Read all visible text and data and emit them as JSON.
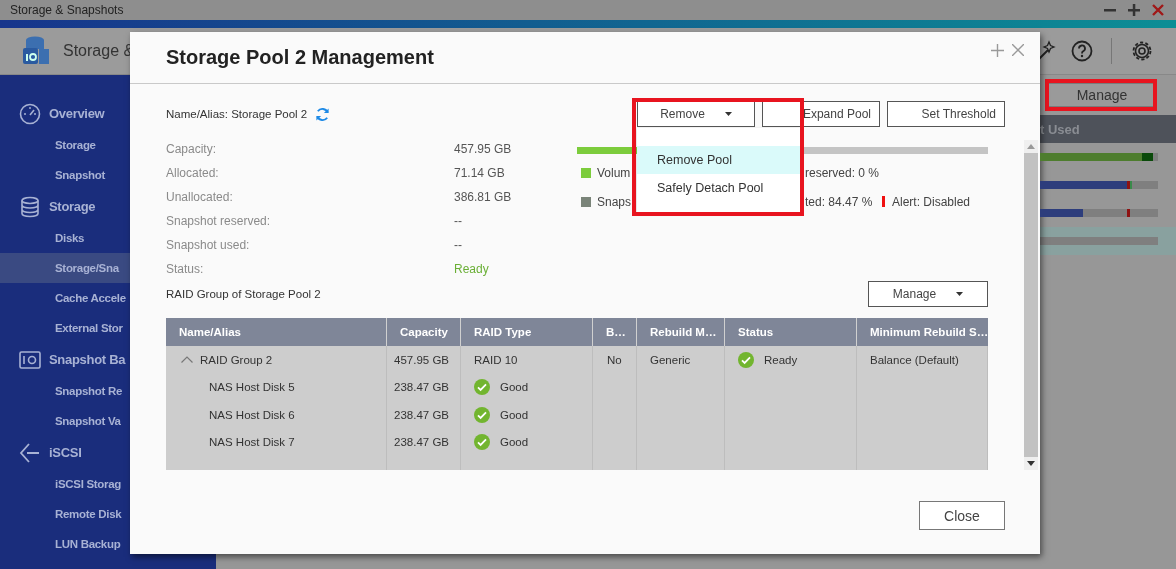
{
  "window": {
    "title": "Storage & Snapshots"
  },
  "app_header": {
    "title": "Storage &"
  },
  "sidebar": {
    "sections": [
      {
        "label": "Overview",
        "children": [
          {
            "label": "Storage",
            "selected": false
          },
          {
            "label": "Snapshot",
            "selected": false
          }
        ]
      },
      {
        "label": "Storage",
        "children": [
          {
            "label": "Disks",
            "selected": false
          },
          {
            "label": "Storage/Sna",
            "selected": true
          },
          {
            "label": "Cache Accele",
            "selected": false
          },
          {
            "label": "External Stor",
            "selected": false
          }
        ]
      },
      {
        "label": "Snapshot Ba",
        "children": [
          {
            "label": "Snapshot Re",
            "selected": false
          },
          {
            "label": "Snapshot Va",
            "selected": false
          }
        ]
      },
      {
        "label": "iSCSI",
        "children": [
          {
            "label": "iSCSI Storag",
            "selected": false
          },
          {
            "label": "Remote Disk",
            "selected": false
          },
          {
            "label": "LUN Backup",
            "selected": false
          }
        ]
      }
    ]
  },
  "main": {
    "manage_button": "Manage",
    "column_header": "t Used",
    "rows": [
      {
        "selected": false,
        "segments": [
          {
            "color": "#4e7d2e",
            "level": 0.864
          },
          {
            "color": "#0a4a0a",
            "level": 0.957
          }
        ]
      },
      {
        "selected": false,
        "segments": [
          {
            "color": "#2d3d7c",
            "level": 0.737
          },
          {
            "color": "#3a8a4a",
            "level": 0.78
          }
        ],
        "marker": {
          "level": 0.754
        }
      },
      {
        "selected": false,
        "segments": [
          {
            "color": "#2d3d7c",
            "level": 0.364
          }
        ],
        "marker": {
          "level": 0.754
        }
      },
      {
        "selected": true
      }
    ]
  },
  "dialog": {
    "title": "Storage Pool 2 Management",
    "name_alias": "Name/Alias: Storage Pool 2",
    "buttons": [
      {
        "label": "Remove",
        "kind": "dropdown",
        "expanded": true
      },
      {
        "label": "Expand Pool",
        "kind": "plain"
      },
      {
        "label": "Set Threshold",
        "kind": "plain"
      }
    ],
    "dropdown_menu": [
      {
        "label": "Remove Pool",
        "selected": true
      },
      {
        "label": "Safely Detach Pool",
        "selected": false
      }
    ],
    "properties": [
      {
        "label": "Capacity:",
        "value": "457.95 GB",
        "kind": "text"
      },
      {
        "label": "Allocated:",
        "value": "71.14 GB",
        "kind": "text"
      },
      {
        "label": "Unallocated:",
        "value": "386.81 GB",
        "kind": "text"
      },
      {
        "label": "Snapshot reserved:",
        "value": "--",
        "kind": "text"
      },
      {
        "label": "Snapshot used:",
        "value": "--",
        "kind": "text"
      },
      {
        "label": "Status:",
        "value": "Ready",
        "kind": "status"
      }
    ],
    "capacity_bar": {
      "level": 0.155
    },
    "legend": [
      {
        "color": "#7ccc3c",
        "label": "Volum",
        "detail": "reserved: 0 %"
      },
      {
        "color": "#7a8479",
        "label": "Snaps",
        "detail": "ted: 84.47 %",
        "alert": "Alert: Disabled"
      }
    ],
    "raid_section": {
      "title": "RAID Group of Storage Pool 2",
      "manage_button": "Manage"
    },
    "table": {
      "columns": [
        "Name/Alias",
        "Capacity",
        "RAID Type",
        "B…",
        "Rebuild M…",
        "Status",
        "Minimum Rebuild S…"
      ],
      "rows": [
        {
          "name": "RAID Group 2",
          "expanded": true,
          "capacity": "457.95 GB",
          "raid_type": "RAID 10",
          "column_4": "No",
          "rebuild": "Generic",
          "status": "Ready",
          "min_rebuild": "Balance (Default)",
          "children": [
            {
              "name": "NAS Host Disk 5",
              "capacity": "238.47 GB",
              "state": "Good"
            },
            {
              "name": "NAS Host Disk 6",
              "capacity": "238.47 GB",
              "state": "Good"
            },
            {
              "name": "NAS Host Disk 7",
              "capacity": "238.47 GB",
              "state": "Good"
            }
          ]
        }
      ]
    },
    "close_button": "Close"
  }
}
